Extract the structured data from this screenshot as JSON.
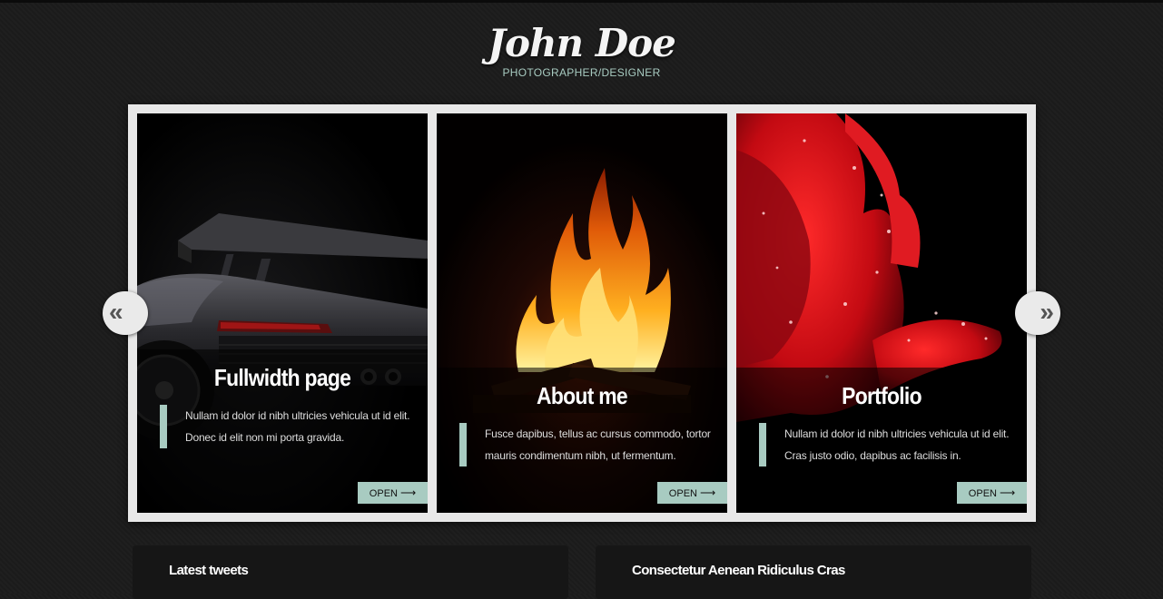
{
  "header": {
    "title": "John Doe",
    "subtitle": "PHOTOGRAPHER/DESIGNER"
  },
  "slider": {
    "prev_label": "«",
    "next_label": "»",
    "open_arrow": "⟶",
    "panels": [
      {
        "title": "Fullwidth page",
        "text": "Nullam id dolor id nibh ultricies vehicula ut id elit. Donec id elit non mi porta gravida.",
        "button": "OPEN",
        "image": "sports-car-rear-photo"
      },
      {
        "title": "About me",
        "text": "Fusce dapibus, tellus ac cursus commodo, tortor mauris condimentum nibh, ut fermentum.",
        "button": "OPEN",
        "image": "campfire-photo"
      },
      {
        "title": "Portfolio",
        "text": "Nullam id dolor id nibh ultricies vehicula ut id elit. Cras justo odio, dapibus ac facilisis in.",
        "button": "OPEN",
        "image": "red-rose-photo"
      }
    ]
  },
  "widgets": {
    "left_title": "Latest tweets",
    "right_title": "Consectetur Aenean Ridiculus Cras"
  },
  "colors": {
    "accent": "#a8cbc1",
    "background": "#1c1c1c",
    "frame": "#e8e8e8"
  }
}
